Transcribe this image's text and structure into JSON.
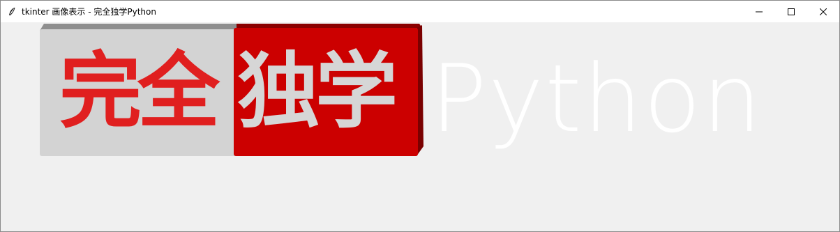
{
  "window": {
    "title": "tkinter 画像表示 - 完全独学Python",
    "icon": "feather-icon",
    "controls": [
      "minimize-icon",
      "maximize-icon",
      "close-icon"
    ]
  },
  "logo": {
    "text_red_part": "完全",
    "text_grey_part": "独学",
    "text_python": "Python",
    "colors": {
      "red": "#cc0000",
      "red_text": "#e01f1f",
      "grey_block": "#d3d3d3",
      "grey_text": "#d6d6d6",
      "python_text": "#ffffff",
      "background": "#f0f0f0"
    }
  }
}
